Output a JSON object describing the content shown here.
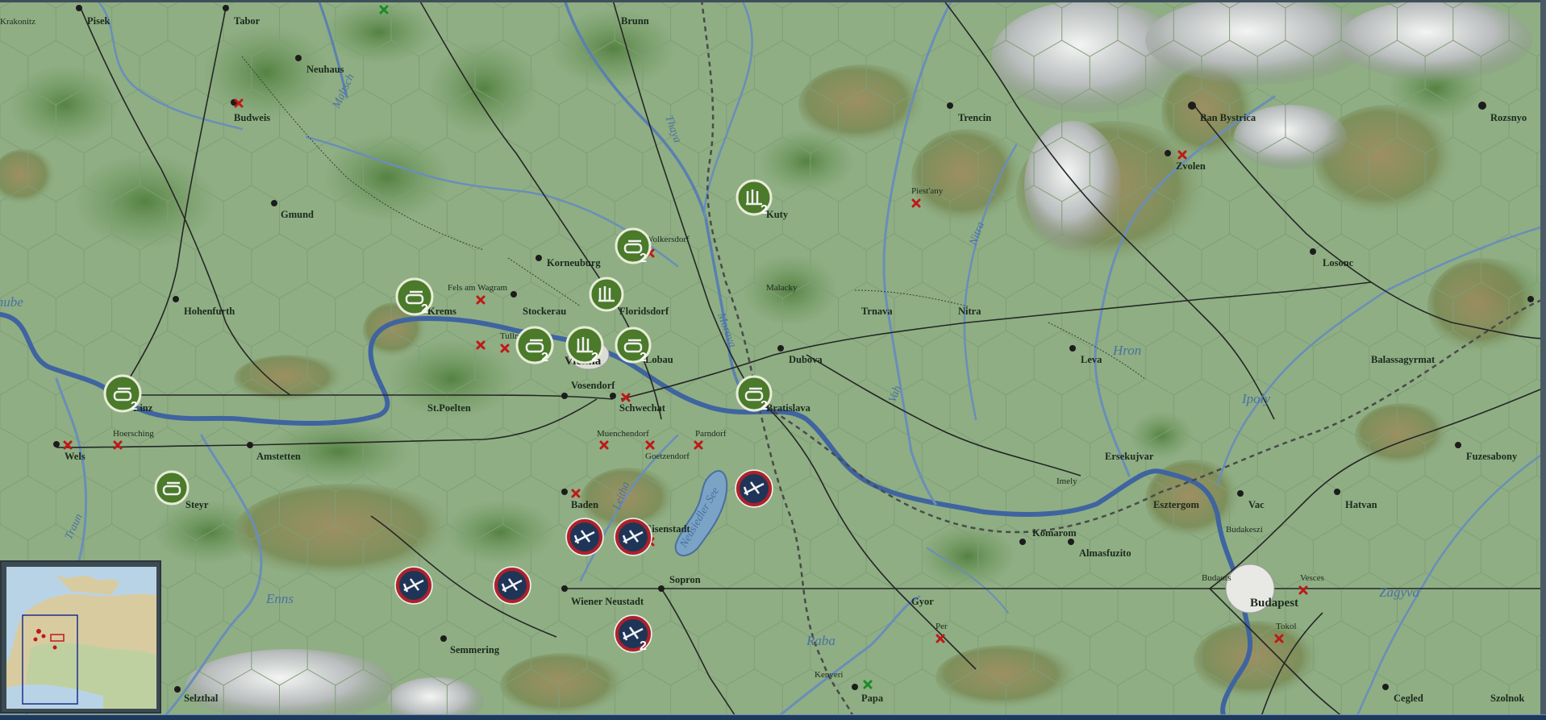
{
  "window": {
    "theme": {
      "land": "#8fae84",
      "river": "#4a6fa0",
      "rail": "#2a2a2a",
      "road": "#555555",
      "forest": "#5f8a4a",
      "unit_green": "#4a7a2a",
      "unit_allied": "#1f3558",
      "unit_allied_ring": "#b02028"
    }
  },
  "cities": [
    {
      "name": "Krakonitz",
      "cls": "small"
    },
    {
      "name": "Pisek",
      "cls": ""
    },
    {
      "name": "Tabor",
      "cls": ""
    },
    {
      "name": "Brunn",
      "cls": ""
    },
    {
      "name": "Neuhaus",
      "cls": ""
    },
    {
      "name": "Budweis",
      "cls": ""
    },
    {
      "name": "Gmund",
      "cls": ""
    },
    {
      "name": "Hohenfurth",
      "cls": ""
    },
    {
      "name": "Linz",
      "cls": ""
    },
    {
      "name": "Wels",
      "cls": ""
    },
    {
      "name": "Hoersching",
      "cls": "small"
    },
    {
      "name": "Steyr",
      "cls": ""
    },
    {
      "name": "Amstetten",
      "cls": ""
    },
    {
      "name": "St.Poelten",
      "cls": ""
    },
    {
      "name": "Krems",
      "cls": ""
    },
    {
      "name": "Fels am Wagram",
      "cls": "small"
    },
    {
      "name": "Stockerau",
      "cls": ""
    },
    {
      "name": "Korneuburg",
      "cls": ""
    },
    {
      "name": "Wolkersdorf",
      "cls": "small"
    },
    {
      "name": "Floridsdorf",
      "cls": ""
    },
    {
      "name": "Tulln",
      "cls": "small"
    },
    {
      "name": "Vienna",
      "cls": "big"
    },
    {
      "name": "Lobau",
      "cls": ""
    },
    {
      "name": "Vosendorf",
      "cls": ""
    },
    {
      "name": "Schwechat",
      "cls": ""
    },
    {
      "name": "Muenchendorf",
      "cls": "small"
    },
    {
      "name": "Parndorf",
      "cls": "small"
    },
    {
      "name": "Goetzendorf",
      "cls": "small"
    },
    {
      "name": "Baden",
      "cls": ""
    },
    {
      "name": "Eisenstadt",
      "cls": ""
    },
    {
      "name": "Wiener Neustadt",
      "cls": ""
    },
    {
      "name": "Sopron",
      "cls": ""
    },
    {
      "name": "Semmering",
      "cls": ""
    },
    {
      "name": "Selzthal",
      "cls": ""
    },
    {
      "name": "Malacky",
      "cls": "small"
    },
    {
      "name": "Kuty",
      "cls": ""
    },
    {
      "name": "Dubova",
      "cls": ""
    },
    {
      "name": "Bratislava",
      "cls": ""
    },
    {
      "name": "Trnava",
      "cls": ""
    },
    {
      "name": "Nitra",
      "cls": ""
    },
    {
      "name": "Piest'any",
      "cls": "small"
    },
    {
      "name": "Trencin",
      "cls": ""
    },
    {
      "name": "Ban Bystrica",
      "cls": ""
    },
    {
      "name": "Zvolen",
      "cls": ""
    },
    {
      "name": "Rozsnyo",
      "cls": ""
    },
    {
      "name": "Losonc",
      "cls": ""
    },
    {
      "name": "Leva",
      "cls": ""
    },
    {
      "name": "Balassagyrmat",
      "cls": ""
    },
    {
      "name": "Ersekujvar",
      "cls": ""
    },
    {
      "name": "Imely",
      "cls": "small"
    },
    {
      "name": "Komarom",
      "cls": ""
    },
    {
      "name": "Almasfuzito",
      "cls": ""
    },
    {
      "name": "Esztergom",
      "cls": ""
    },
    {
      "name": "Vac",
      "cls": ""
    },
    {
      "name": "Hatvan",
      "cls": ""
    },
    {
      "name": "Fuzesabony",
      "cls": ""
    },
    {
      "name": "Budakeszi",
      "cls": "small"
    },
    {
      "name": "Budaors",
      "cls": "small"
    },
    {
      "name": "Budapest",
      "cls": "big"
    },
    {
      "name": "Vesces",
      "cls": "small"
    },
    {
      "name": "Tokol",
      "cls": "small"
    },
    {
      "name": "Gyor",
      "cls": ""
    },
    {
      "name": "Per",
      "cls": "small"
    },
    {
      "name": "Kenyeri",
      "cls": "small"
    },
    {
      "name": "Papa",
      "cls": ""
    },
    {
      "name": "Cegled",
      "cls": ""
    },
    {
      "name": "Szolnok",
      "cls": ""
    }
  ],
  "rivers": [
    {
      "name": "Danube"
    },
    {
      "name": "Maltsch"
    },
    {
      "name": "Traun"
    },
    {
      "name": "Enns"
    },
    {
      "name": "Leitha"
    },
    {
      "name": "Neusiedler See"
    },
    {
      "name": "Morava"
    },
    {
      "name": "Thaya"
    },
    {
      "name": "Vah"
    },
    {
      "name": "Nitra"
    },
    {
      "name": "Hron"
    },
    {
      "name": "Ipoly"
    },
    {
      "name": "Zagyva"
    },
    {
      "name": "Raba"
    }
  ],
  "units": {
    "axis": [
      {
        "id": "linz",
        "count": "2"
      },
      {
        "id": "steyr",
        "count": ""
      },
      {
        "id": "krems",
        "count": "2"
      },
      {
        "id": "tulln",
        "count": "2"
      },
      {
        "id": "vienna",
        "count": "2"
      },
      {
        "id": "floridsdorf-arty",
        "count": ""
      },
      {
        "id": "lobau",
        "count": "2"
      },
      {
        "id": "wolkersdorf",
        "count": "2"
      },
      {
        "id": "kuty",
        "count": "2"
      },
      {
        "id": "bratislava",
        "count": "2"
      }
    ],
    "allied": [
      {
        "id": "neusiedl",
        "count": ""
      },
      {
        "id": "baden",
        "count": ""
      },
      {
        "id": "eisenstadt",
        "count": ""
      },
      {
        "id": "semmering-w",
        "count": ""
      },
      {
        "id": "semmering-e",
        "count": ""
      },
      {
        "id": "sopron",
        "count": "2"
      }
    ]
  },
  "minimap": {
    "label": "minimap"
  }
}
